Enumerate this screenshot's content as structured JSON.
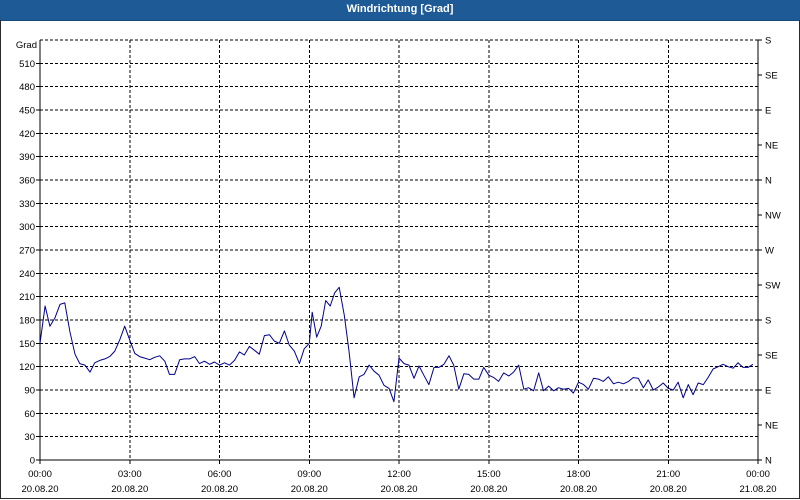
{
  "window": {
    "title": "Windrichtung [Grad]"
  },
  "chart_data": {
    "type": "line",
    "title": "Windrichtung [Grad]",
    "ylabel": "Grad",
    "ylim": [
      0,
      540
    ],
    "y_ticks": [
      0,
      30,
      60,
      90,
      120,
      150,
      180,
      210,
      240,
      270,
      300,
      330,
      360,
      390,
      420,
      450,
      480,
      510
    ],
    "right_axis": {
      "degrees": [
        0,
        45,
        90,
        135,
        180,
        225,
        270,
        315,
        360,
        405,
        450,
        495,
        540
      ],
      "labels": [
        "N",
        "NE",
        "E",
        "SE",
        "S",
        "SW",
        "W",
        "NW",
        "N",
        "NE",
        "E",
        "SE",
        "S"
      ]
    },
    "x_range_hours": [
      0,
      24
    ],
    "x_ticks": [
      {
        "time": "00:00",
        "date": "20.08.20"
      },
      {
        "time": "03:00",
        "date": "20.08.20"
      },
      {
        "time": "06:00",
        "date": "20.08.20"
      },
      {
        "time": "09:00",
        "date": "20.08.20"
      },
      {
        "time": "12:00",
        "date": "20.08.20"
      },
      {
        "time": "15:00",
        "date": "20.08.20"
      },
      {
        "time": "18:00",
        "date": "20.08.20"
      },
      {
        "time": "21:00",
        "date": "20.08.20"
      },
      {
        "time": "00:00",
        "date": "21.08.20"
      }
    ],
    "grid": true,
    "line_color": "#00008b",
    "series": [
      {
        "values": [
          [
            0.0,
            150
          ],
          [
            0.17,
            198
          ],
          [
            0.33,
            172
          ],
          [
            0.5,
            183
          ],
          [
            0.67,
            200
          ],
          [
            0.83,
            202
          ],
          [
            1.0,
            165
          ],
          [
            1.17,
            136
          ],
          [
            1.33,
            124
          ],
          [
            1.5,
            122
          ],
          [
            1.67,
            113
          ],
          [
            1.83,
            125
          ],
          [
            2.0,
            128
          ],
          [
            2.17,
            130
          ],
          [
            2.33,
            133
          ],
          [
            2.5,
            140
          ],
          [
            2.67,
            155
          ],
          [
            2.83,
            172
          ],
          [
            3.0,
            154
          ],
          [
            3.17,
            137
          ],
          [
            3.33,
            133
          ],
          [
            3.5,
            131
          ],
          [
            3.67,
            129
          ],
          [
            3.83,
            132
          ],
          [
            4.0,
            134
          ],
          [
            4.17,
            127
          ],
          [
            4.33,
            110
          ],
          [
            4.5,
            110
          ],
          [
            4.67,
            129
          ],
          [
            4.83,
            130
          ],
          [
            5.0,
            130
          ],
          [
            5.17,
            133
          ],
          [
            5.33,
            124
          ],
          [
            5.5,
            127
          ],
          [
            5.67,
            123
          ],
          [
            5.83,
            126
          ],
          [
            6.0,
            122
          ],
          [
            6.17,
            125
          ],
          [
            6.33,
            122
          ],
          [
            6.5,
            128
          ],
          [
            6.67,
            139
          ],
          [
            6.83,
            135
          ],
          [
            7.0,
            146
          ],
          [
            7.17,
            141
          ],
          [
            7.33,
            136
          ],
          [
            7.5,
            160
          ],
          [
            7.67,
            161
          ],
          [
            7.83,
            153
          ],
          [
            8.0,
            150
          ],
          [
            8.17,
            166
          ],
          [
            8.33,
            148
          ],
          [
            8.5,
            140
          ],
          [
            8.67,
            124
          ],
          [
            8.83,
            143
          ],
          [
            9.0,
            150
          ],
          [
            9.1,
            190
          ],
          [
            9.25,
            158
          ],
          [
            9.4,
            172
          ],
          [
            9.55,
            205
          ],
          [
            9.7,
            198
          ],
          [
            9.85,
            215
          ],
          [
            10.0,
            222
          ],
          [
            10.17,
            186
          ],
          [
            10.33,
            140
          ],
          [
            10.5,
            80
          ],
          [
            10.67,
            107
          ],
          [
            10.83,
            110
          ],
          [
            11.0,
            122
          ],
          [
            11.17,
            114
          ],
          [
            11.33,
            109
          ],
          [
            11.5,
            96
          ],
          [
            11.67,
            92
          ],
          [
            11.83,
            75
          ],
          [
            12.0,
            131
          ],
          [
            12.17,
            124
          ],
          [
            12.33,
            122
          ],
          [
            12.5,
            105
          ],
          [
            12.67,
            121
          ],
          [
            12.83,
            109
          ],
          [
            13.0,
            97
          ],
          [
            13.17,
            119
          ],
          [
            13.33,
            119
          ],
          [
            13.5,
            123
          ],
          [
            13.67,
            134
          ],
          [
            13.83,
            122
          ],
          [
            14.0,
            91
          ],
          [
            14.17,
            111
          ],
          [
            14.33,
            110
          ],
          [
            14.5,
            104
          ],
          [
            14.67,
            104
          ],
          [
            14.83,
            119
          ],
          [
            15.0,
            109
          ],
          [
            15.17,
            106
          ],
          [
            15.33,
            101
          ],
          [
            15.5,
            112
          ],
          [
            15.67,
            108
          ],
          [
            15.83,
            113
          ],
          [
            16.0,
            122
          ],
          [
            16.17,
            91
          ],
          [
            16.33,
            93
          ],
          [
            16.5,
            89
          ],
          [
            16.67,
            112
          ],
          [
            16.83,
            89
          ],
          [
            17.0,
            95
          ],
          [
            17.17,
            89
          ],
          [
            17.33,
            93
          ],
          [
            17.5,
            91
          ],
          [
            17.67,
            92
          ],
          [
            17.83,
            86
          ],
          [
            18.0,
            100
          ],
          [
            18.17,
            97
          ],
          [
            18.33,
            91
          ],
          [
            18.5,
            105
          ],
          [
            18.67,
            104
          ],
          [
            18.83,
            101
          ],
          [
            19.0,
            107
          ],
          [
            19.17,
            98
          ],
          [
            19.33,
            100
          ],
          [
            19.5,
            98
          ],
          [
            19.67,
            101
          ],
          [
            19.83,
            106
          ],
          [
            20.0,
            105
          ],
          [
            20.17,
            93
          ],
          [
            20.33,
            103
          ],
          [
            20.5,
            90
          ],
          [
            20.67,
            94
          ],
          [
            20.83,
            99
          ],
          [
            21.0,
            92
          ],
          [
            21.17,
            90
          ],
          [
            21.33,
            100
          ],
          [
            21.5,
            80
          ],
          [
            21.67,
            97
          ],
          [
            21.83,
            84
          ],
          [
            22.0,
            99
          ],
          [
            22.17,
            97
          ],
          [
            22.33,
            106
          ],
          [
            22.5,
            117
          ],
          [
            22.67,
            120
          ],
          [
            22.83,
            123
          ],
          [
            23.0,
            120
          ],
          [
            23.17,
            118
          ],
          [
            23.33,
            125
          ],
          [
            23.5,
            119
          ],
          [
            23.67,
            119
          ],
          [
            23.83,
            123
          ]
        ]
      }
    ]
  }
}
